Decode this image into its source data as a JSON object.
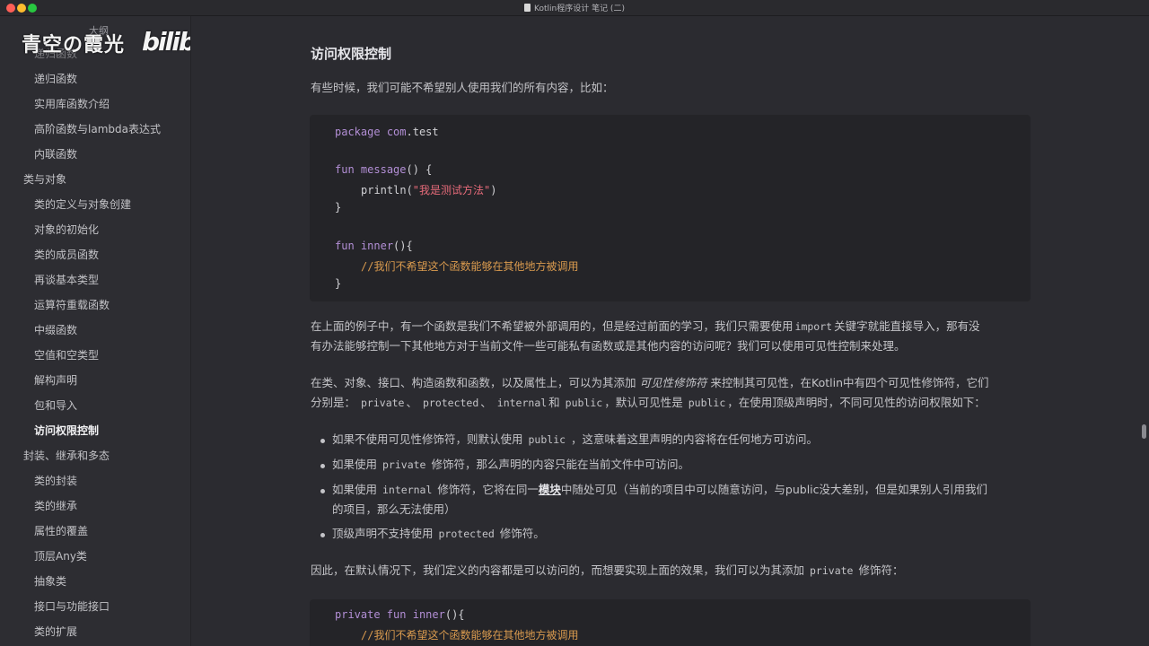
{
  "window": {
    "title": "Kotlin程序设计 笔记 (二)"
  },
  "sidebar": {
    "outline_label": "大纲",
    "watermark": "青空の霞光",
    "logo": "bilibili",
    "items": [
      {
        "label": "递归函数",
        "level": 2,
        "state": "partial"
      },
      {
        "label": "递归函数",
        "level": 2
      },
      {
        "label": "实用库函数介绍",
        "level": 2
      },
      {
        "label": "高阶函数与lambda表达式",
        "level": 2
      },
      {
        "label": "内联函数",
        "level": 2
      },
      {
        "label": "类与对象",
        "level": 1
      },
      {
        "label": "类的定义与对象创建",
        "level": 2
      },
      {
        "label": "对象的初始化",
        "level": 2
      },
      {
        "label": "类的成员函数",
        "level": 2
      },
      {
        "label": "再谈基本类型",
        "level": 2
      },
      {
        "label": "运算符重载函数",
        "level": 2
      },
      {
        "label": "中缀函数",
        "level": 2
      },
      {
        "label": "空值和空类型",
        "level": 2
      },
      {
        "label": "解构声明",
        "level": 2
      },
      {
        "label": "包和导入",
        "level": 2
      },
      {
        "label": "访问权限控制",
        "level": 2,
        "state": "active"
      },
      {
        "label": "封装、继承和多态",
        "level": 1
      },
      {
        "label": "类的封装",
        "level": 2
      },
      {
        "label": "类的继承",
        "level": 2
      },
      {
        "label": "属性的覆盖",
        "level": 2
      },
      {
        "label": "顶层Any类",
        "level": 2
      },
      {
        "label": "抽象类",
        "level": 2
      },
      {
        "label": "接口与功能接口",
        "level": 2
      },
      {
        "label": "类的扩展",
        "level": 2
      }
    ]
  },
  "content": {
    "heading": "访问权限控制",
    "intro": "有些时候，我们可能不希望别人使用我们的所有内容，比如：",
    "code1": {
      "l1_kw": "package",
      "l1_pkg": "com",
      "l1_rest": ".test",
      "l2_kw": "fun",
      "l2_fn": "message",
      "l2_rest": "() {",
      "l3_call": "println(",
      "l3_str": "\"我是测试方法\"",
      "l3_close": ")",
      "l4": "}",
      "l5_kw": "fun",
      "l5_fn": "inner",
      "l5_rest": "(){",
      "l6_cmt": "//我们不希望这个函数能够在其他地方被调用",
      "l7": "}"
    },
    "p2_a": "在上面的例子中，有一个函数是我们不希望被外部调用的，但是经过前面的学习，我们只需要使用",
    "p2_code": "import",
    "p2_b": "关键字就能直接导入，那有没",
    "p2_c": "有办法能够控制一下其他地方对于当前文件一些可能私有函数或是其他内容的访问呢？我们可以使用可见性控制来处理。",
    "p3_a": "在类、对象、接口、构造函数和函数，以及属性上，可以为其添加",
    "p3_em": "可见性修饰符",
    "p3_b": "来控制其可见性，在Kotlin中有四个可见性修饰符，它们",
    "p3_c": "分别是：",
    "p3_m1": "private",
    "p3_sep1": "、",
    "p3_m2": "protected",
    "p3_sep2": "、",
    "p3_m3": "internal",
    "p3_and": "和",
    "p3_m4": "public",
    "p3_d": "，默认可见性是",
    "p3_m5": "public",
    "p3_e": "，在使用顶级声明时，不同可见性的访问权限如下：",
    "li1_a": "如果不使用可见性修饰符，则默认使用",
    "li1_code": "public",
    "li1_b": "，这意味着这里声明的内容将在任何地方可访问。",
    "li2_a": "如果使用",
    "li2_code": "private",
    "li2_b": "修饰符，那么声明的内容只能在当前文件中可访问。",
    "li3_a": "如果使用",
    "li3_code": "internal",
    "li3_b": "修饰符，它将在同一",
    "li3_u": "模块",
    "li3_c": "中随处可见（当前的项目中可以随意访问，与public没大差别，但是如果别人引用我们",
    "li3_d": "的项目，那么无法使用）",
    "li4_a": "顶级声明不支持使用",
    "li4_code": "protected",
    "li4_b": "修饰符。",
    "p4_a": "因此，在默认情况下，我们定义的内容都是可以访问的，而想要实现上面的效果，我们可以为其添加",
    "p4_code": "private",
    "p4_b": "修饰符：",
    "code2": {
      "l1_kw": "private fun",
      "l1_fn": "inner",
      "l1_rest": "(){",
      "l2_cmt": "//我们不希望这个函数能够在其他地方被调用"
    }
  }
}
